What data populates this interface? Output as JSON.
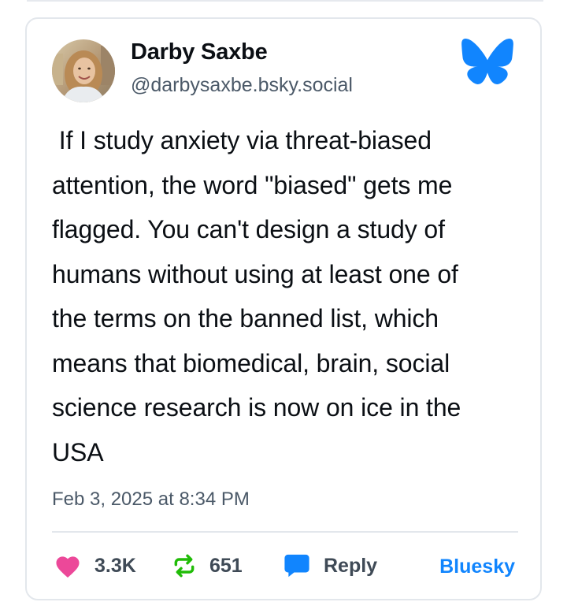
{
  "post": {
    "author_name": "Darby Saxbe",
    "author_handle": "@darbysaxbe.bsky.social",
    "text": " If I study anxiety via threat-biased\nattention, the word \"biased\" gets me\nflagged. You can't design a study of\nhumans without using at least one of\nthe terms on the banned list, which\nmeans that biomedical, brain, social\nscience research is now on ice in the\nUSA",
    "timestamp": "Feb 3, 2025 at 8:34 PM"
  },
  "stats": {
    "likes": "3.3K",
    "reposts": "651",
    "reply_label": "Reply"
  },
  "footer": {
    "platform_link": "Bluesky"
  },
  "icons": {
    "brand": "bluesky-butterfly-icon",
    "like": "heart-icon",
    "repost": "repost-icon",
    "reply": "speech-bubble-icon"
  },
  "colors": {
    "brand_blue": "#1185fe",
    "heart_pink": "#ec4899",
    "repost_green": "#20bc07",
    "text_primary": "#0b0f14",
    "text_secondary": "#4b5968"
  }
}
